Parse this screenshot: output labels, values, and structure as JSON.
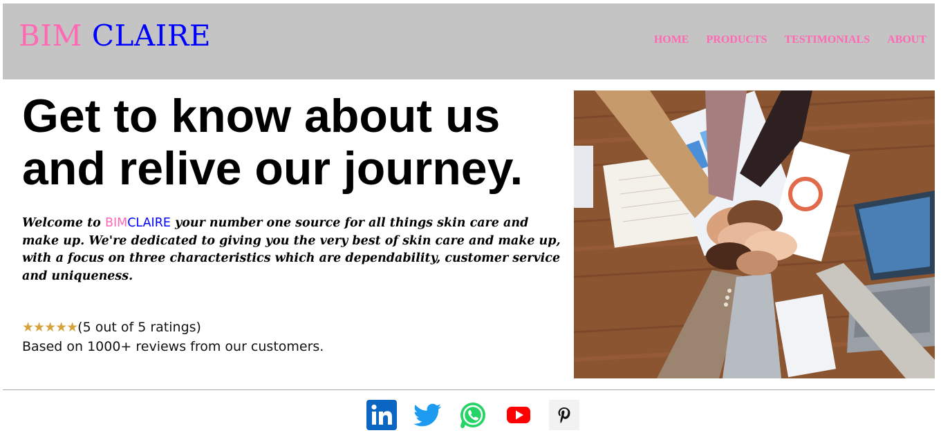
{
  "header": {
    "logo_part1": "BIM",
    "logo_part2": "CLAIRE",
    "nav": [
      "HOME",
      "PRODUCTS",
      "TESTIMONIALS",
      "ABOUT"
    ]
  },
  "hero": {
    "headline": "Get to know about us and relive our journey.",
    "intro_before": "Welcome to ",
    "brand_part1": "BIM",
    "brand_part2": "CLAIRE",
    "intro_after": " your number one source for all things skin care and make up. We're dedicated to giving you the very best of skin care and make up, with a focus on three characteristics which are dependability, customer service and uniqueness.",
    "rating_stars": "★★★★★",
    "rating_text": "(5 out of 5 ratings)",
    "rating_value": 5,
    "rating_max": 5,
    "reviews_text": "Based on 1000+ reviews from our customers."
  },
  "social_icons": [
    "linkedin-icon",
    "twitter-icon",
    "whatsapp-icon",
    "youtube-icon",
    "pinterest-icon"
  ],
  "colors": {
    "header_bg": "#c4c4c4",
    "brand_pink": "#ff69b4",
    "brand_blue": "#0000ff",
    "star_gold": "#d4a43a"
  }
}
